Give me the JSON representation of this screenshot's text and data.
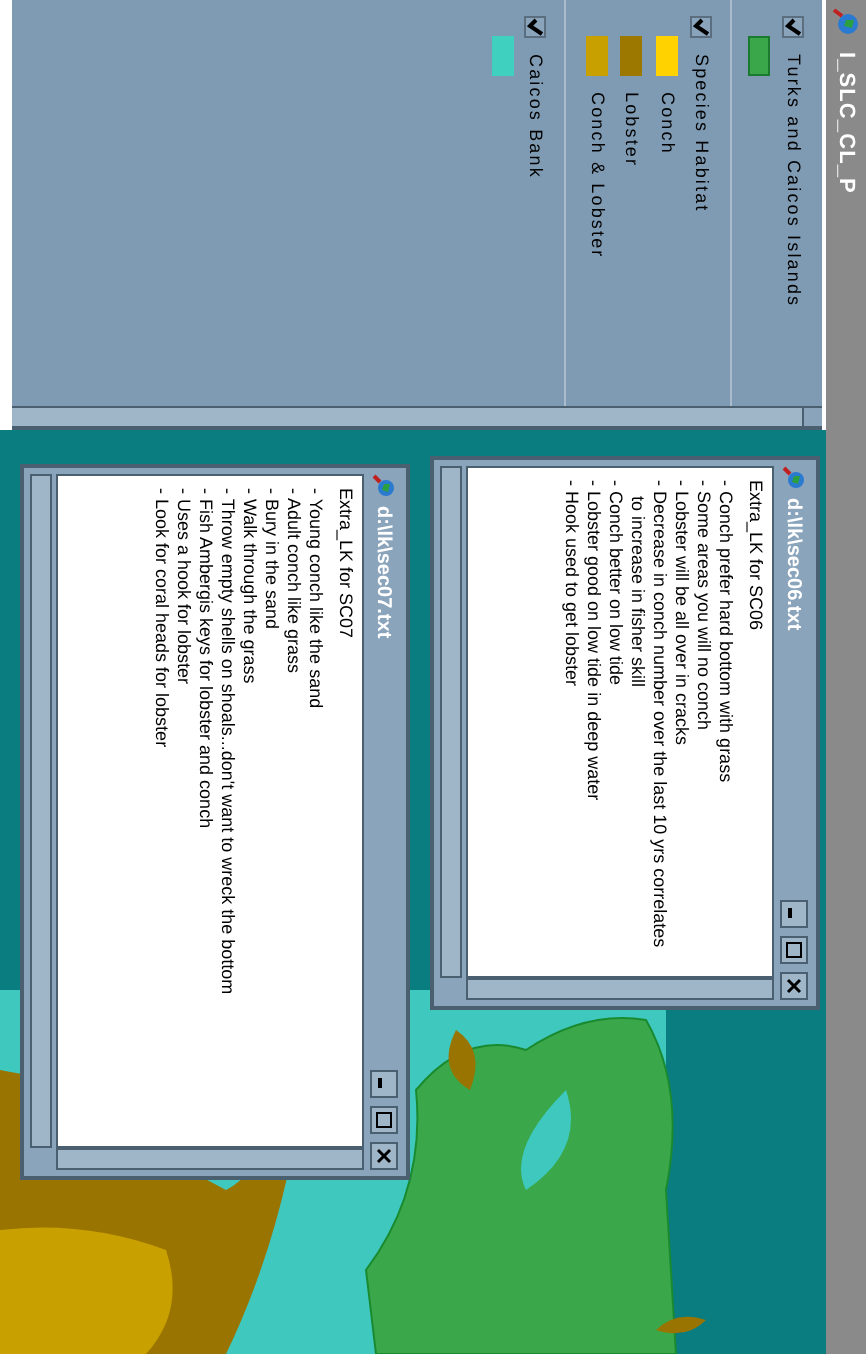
{
  "window": {
    "title": "I_SLC_CL_P"
  },
  "legend": {
    "themes": [
      {
        "name": "Turks and Caicos Islands",
        "visible": true,
        "classes": [
          {
            "color": "#3aa84a"
          }
        ]
      },
      {
        "name": "Species Habitat",
        "visible": true,
        "classes": [
          {
            "label": "Conch",
            "color": "#ffd200"
          },
          {
            "label": "Lobster",
            "color": "#9c7800"
          },
          {
            "label": "Conch & Lobster",
            "color": "#c8a000"
          }
        ]
      },
      {
        "name": "Caicos Bank",
        "visible": true,
        "classes": [
          {
            "color": "#40d0c0"
          }
        ]
      }
    ]
  },
  "text_windows": [
    {
      "title": "d:\\lk\\sec06.txt",
      "heading": "Extra_LK for SC06",
      "lines": [
        "- Conch prefer hard bottom with grass",
        "- Some areas you will no conch",
        "- Lobster will be all over in cracks",
        "- Decrease in conch number over the last 10 yrs correlates to increase in fisher skill",
        "- Conch better on low tide",
        "- Lobster good on low tide in deep water",
        "- Hook used to get lobster"
      ]
    },
    {
      "title": "d:\\lk\\sec07.txt",
      "heading": "Extra_LK for SC07",
      "lines": [
        "- Young conch like the sand",
        "- Adult conch like grass",
        "- Bury in the sand",
        "- Walk through the grass",
        "- Throw empty shells on shoals...don't want to wreck the bottom",
        "- Fish Ambergis keys for lobster and conch",
        "- Uses a hook for lobster",
        "- Look for coral heads for lobster"
      ]
    }
  ]
}
